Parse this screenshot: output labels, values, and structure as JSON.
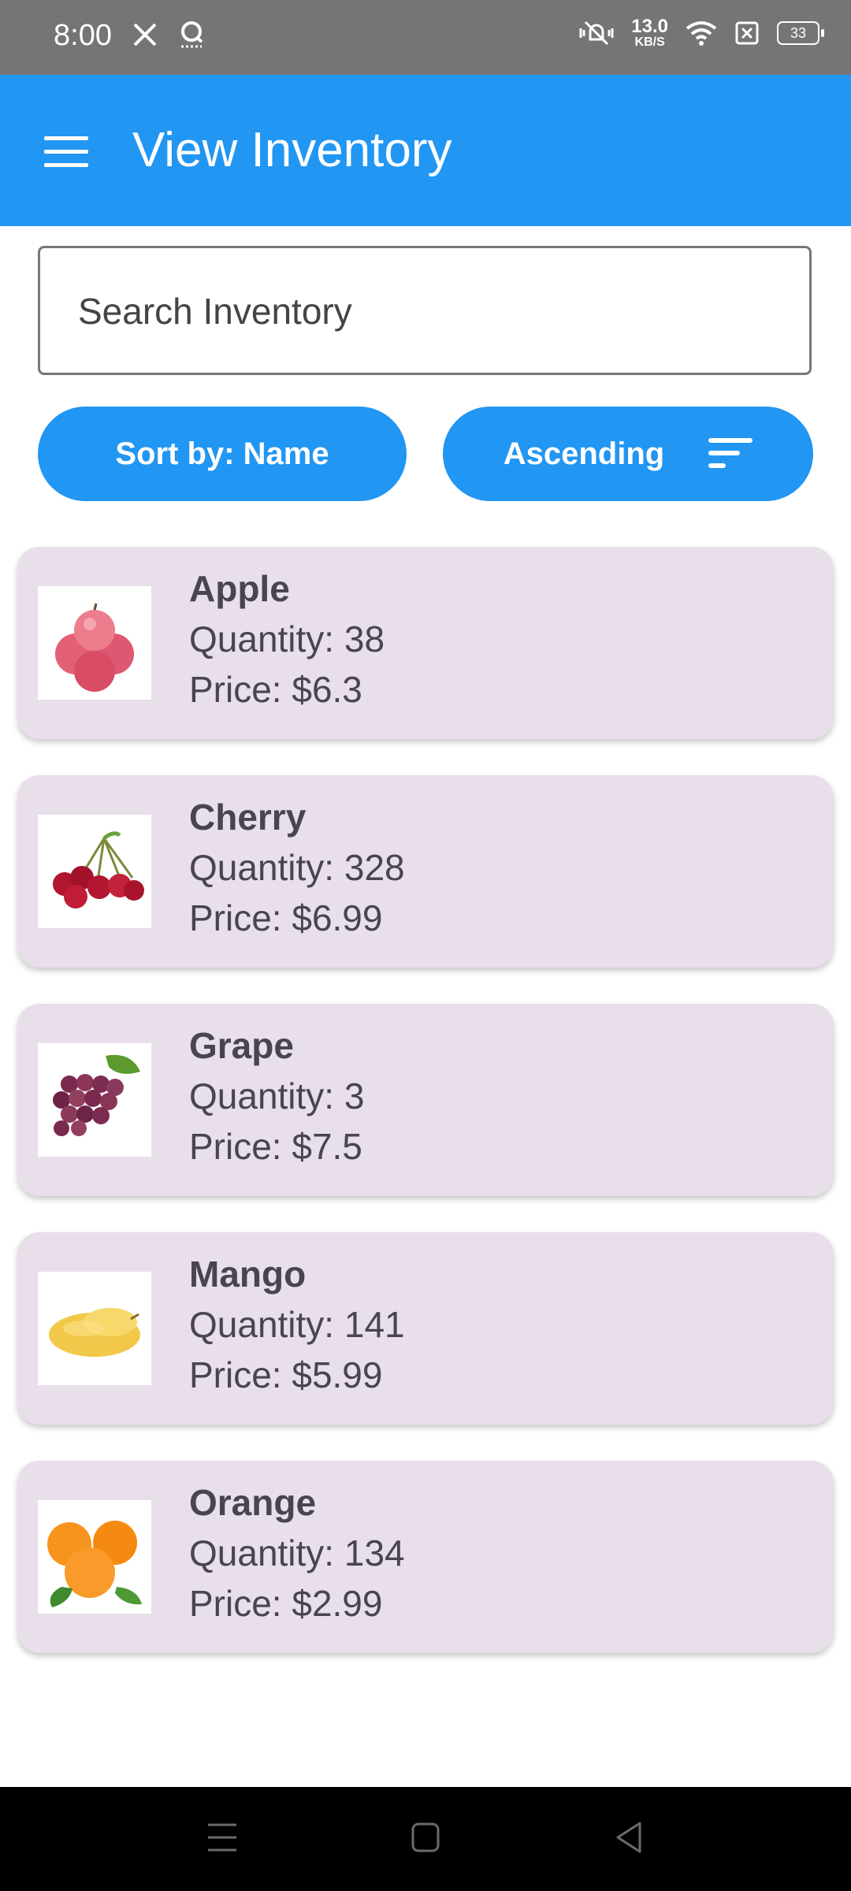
{
  "status_bar": {
    "time": "8:00",
    "net_speed_value": "13.0",
    "net_speed_unit": "KB/S",
    "battery": "33",
    "icons": [
      "x-app-icon",
      "notification-icon",
      "mute-vibrate-icon",
      "wifi-icon",
      "no-sim-icon",
      "battery-icon"
    ]
  },
  "app_bar": {
    "title": "View Inventory",
    "menu_icon": "hamburger-menu-icon",
    "background": "#2196F3"
  },
  "search": {
    "placeholder": "Search Inventory",
    "value": ""
  },
  "controls": {
    "sort_label": "Sort by: Name",
    "order_label": "Ascending",
    "order_icon": "sort-icon"
  },
  "items": [
    {
      "name": "Apple",
      "quantity": "Quantity: 38",
      "price": "Price: $6.3"
    },
    {
      "name": "Cherry",
      "quantity": "Quantity: 328",
      "price": "Price: $6.99"
    },
    {
      "name": "Grape",
      "quantity": "Quantity: 3",
      "price": "Price: $7.5"
    },
    {
      "name": "Mango",
      "quantity": "Quantity: 141",
      "price": "Price: $5.99"
    },
    {
      "name": "Orange",
      "quantity": "Quantity: 134",
      "price": "Price: $2.99"
    }
  ],
  "nav_bar": {
    "icons": [
      "recents-icon",
      "home-icon",
      "back-icon"
    ]
  },
  "colors": {
    "accent": "#2196F3",
    "card": "#e8dfea",
    "status_bar": "#757575"
  }
}
